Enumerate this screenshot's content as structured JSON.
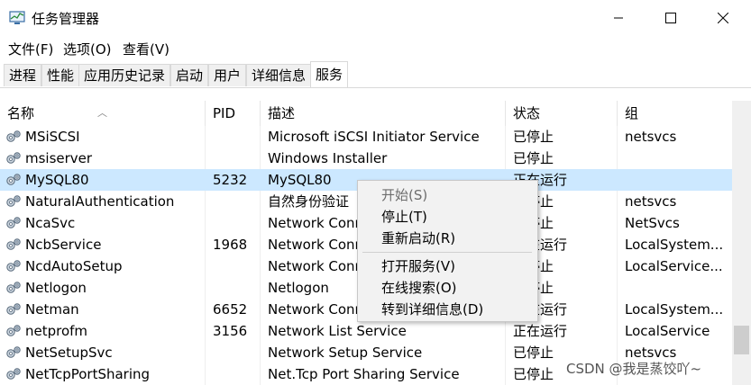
{
  "window": {
    "title": "任务管理器",
    "minimize": "—",
    "maximize": "☐",
    "close": "✕"
  },
  "menu": [
    "文件(F)",
    "选项(O)",
    "查看(V)"
  ],
  "tabs": [
    "进程",
    "性能",
    "应用历史记录",
    "启动",
    "用户",
    "详细信息",
    "服务"
  ],
  "active_tab": "服务",
  "columns": [
    "名称",
    "PID",
    "描述",
    "状态",
    "组"
  ],
  "rows": [
    {
      "name": "MSiSCSI",
      "pid": "",
      "desc": "Microsoft iSCSI Initiator Service",
      "status": "已停止",
      "group": "netsvcs"
    },
    {
      "name": "msiserver",
      "pid": "",
      "desc": "Windows Installer",
      "status": "已停止",
      "group": ""
    },
    {
      "name": "MySQL80",
      "pid": "5232",
      "desc": "MySQL80",
      "status": "正在运行",
      "group": ""
    },
    {
      "name": "NaturalAuthentication",
      "pid": "",
      "desc": "自然身份验证",
      "status": "已停止",
      "group": "netsvcs"
    },
    {
      "name": "NcaSvc",
      "pid": "",
      "desc": "Network Connectivity Assistant",
      "status": "已停止",
      "group": "NetSvcs"
    },
    {
      "name": "NcbService",
      "pid": "1968",
      "desc": "Network Connection Broker",
      "status": "正在运行",
      "group": "LocalSystem..."
    },
    {
      "name": "NcdAutoSetup",
      "pid": "",
      "desc": "Network Connected Devices Auto-Setup",
      "status": "已停止",
      "group": "LocalService..."
    },
    {
      "name": "Netlogon",
      "pid": "",
      "desc": "Netlogon",
      "status": "已停止",
      "group": ""
    },
    {
      "name": "Netman",
      "pid": "6652",
      "desc": "Network Connections",
      "status": "正在运行",
      "group": "LocalSystem..."
    },
    {
      "name": "netprofm",
      "pid": "3156",
      "desc": "Network List Service",
      "status": "正在运行",
      "group": "LocalService"
    },
    {
      "name": "NetSetupSvc",
      "pid": "",
      "desc": "Network Setup Service",
      "status": "已停止",
      "group": "netsvcs"
    },
    {
      "name": "NetTcpPortSharing",
      "pid": "",
      "desc": "Net.Tcp Port Sharing Service",
      "status": "已停止",
      "group": ""
    }
  ],
  "selected_row": "MySQL80",
  "context_menu": {
    "start": "开始(S)",
    "stop": "停止(T)",
    "restart": "重新启动(R)",
    "open_services": "打开服务(V)",
    "search_online": "在线搜索(O)",
    "go_to_details": "转到详细信息(D)"
  },
  "watermark": "CSDN @我是蒸饺吖~"
}
